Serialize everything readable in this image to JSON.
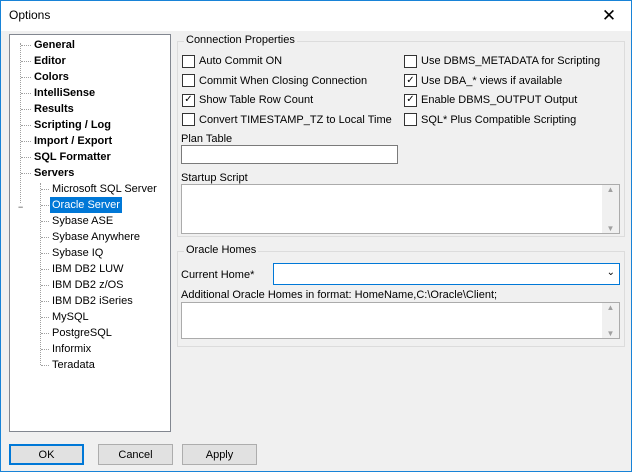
{
  "window": {
    "title": "Options"
  },
  "tree": {
    "root_items": [
      "General",
      "Editor",
      "Colors",
      "IntelliSense",
      "Results",
      "Scripting / Log",
      "Import / Export",
      "SQL Formatter",
      "Servers"
    ],
    "server_items": [
      "Microsoft SQL Server",
      "Oracle Server",
      "Sybase ASE",
      "Sybase Anywhere",
      "Sybase IQ",
      "IBM DB2 LUW",
      "IBM DB2 z/OS",
      "IBM DB2 iSeries",
      "MySQL",
      "PostgreSQL",
      "Informix",
      "Teradata"
    ],
    "selected": "Oracle Server",
    "expander": "−"
  },
  "connection": {
    "legend": "Connection Properties",
    "checkboxes_left": [
      {
        "label": "Auto Commit ON",
        "checked": false
      },
      {
        "label": "Commit When Closing Connection",
        "checked": false
      },
      {
        "label": "Show Table Row Count",
        "checked": true
      },
      {
        "label": "Convert TIMESTAMP_TZ to Local Time",
        "checked": false
      }
    ],
    "checkboxes_right": [
      {
        "label": "Use DBMS_METADATA for Scripting",
        "checked": false
      },
      {
        "label": "Use DBA_* views if available",
        "checked": true
      },
      {
        "label": "Enable DBMS_OUTPUT Output",
        "checked": true
      },
      {
        "label": "SQL* Plus Compatible Scripting",
        "checked": false
      }
    ],
    "plan_table_label": "Plan Table",
    "plan_table_value": "",
    "startup_script_label": "Startup Script",
    "startup_script_value": ""
  },
  "oracle_homes": {
    "legend": "Oracle Homes",
    "current_home_label": "Current Home*",
    "current_home_value": "",
    "additional_label": "Additional Oracle Homes in format: HomeName,C:\\Oracle\\Client;",
    "additional_value": ""
  },
  "buttons": {
    "ok": "OK",
    "cancel": "Cancel",
    "apply": "Apply"
  },
  "colors": {
    "accent": "#0078d7",
    "window_border": "#1883d7"
  }
}
